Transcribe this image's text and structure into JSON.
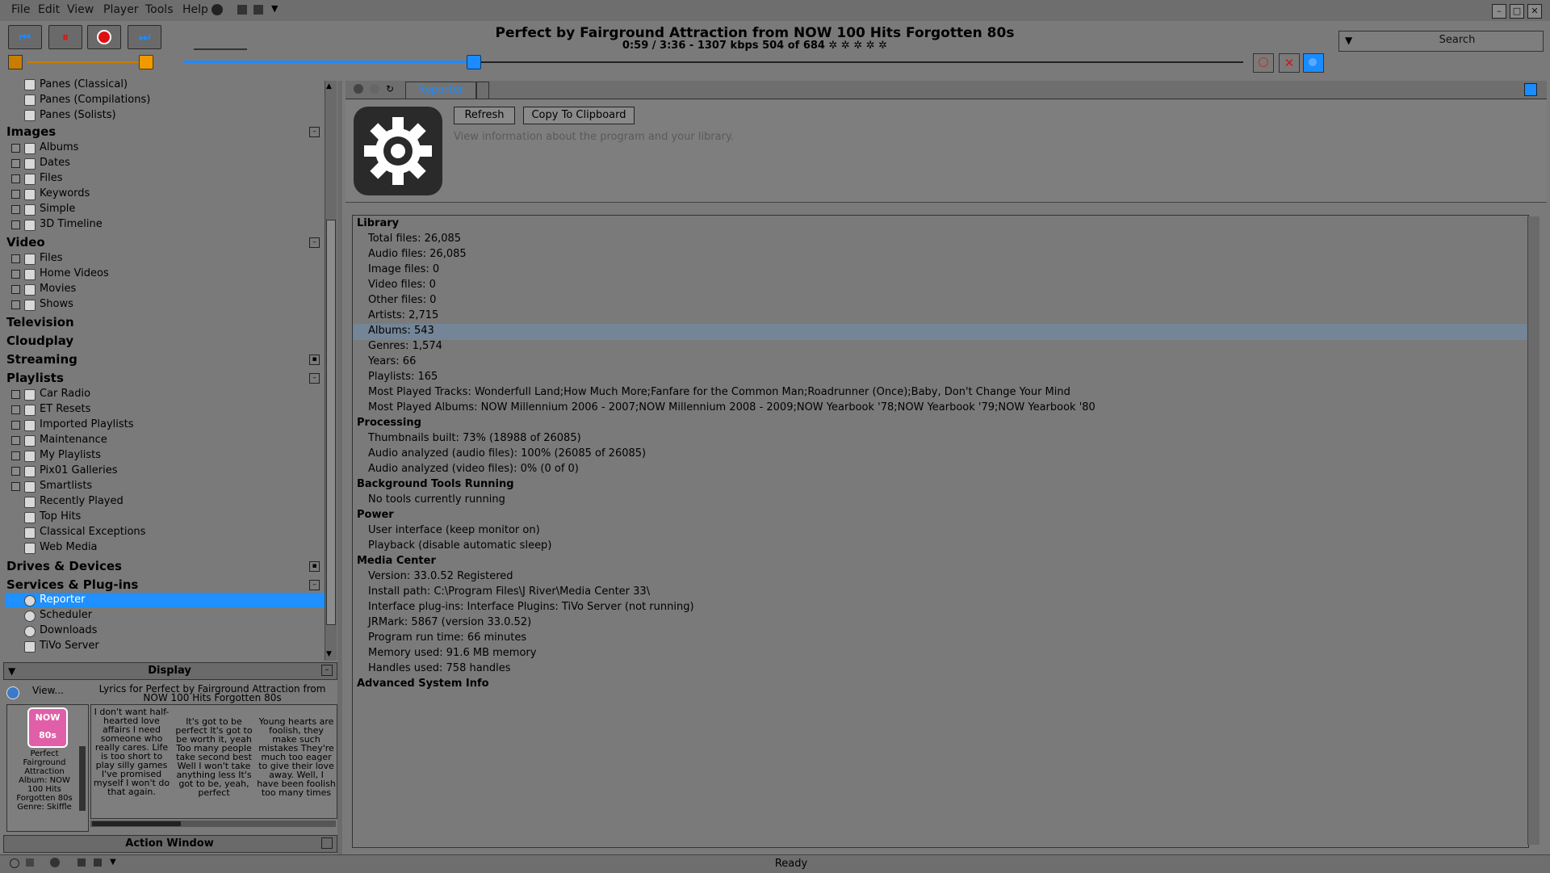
{
  "menu": [
    "File",
    "Edit",
    "View",
    "Player",
    "Tools",
    "Help"
  ],
  "now_playing": {
    "title": "Perfect by Fairground Attraction from NOW 100 Hits Forgotten 80s",
    "subtitle": "0:59 / 3:36 - 1307 kbps   504 of 684 ✲ ✲ ✲ ✲ ✲"
  },
  "playback": {
    "position_fraction": 0.273,
    "volume_fraction": 0.97
  },
  "search": {
    "label": "Search"
  },
  "tree": {
    "audio_items": [
      "Panes (Classical)",
      "Panes (Compilations)",
      "Panes (Solists)"
    ],
    "images": {
      "label": "Images",
      "items": [
        "Albums",
        "Dates",
        "Files",
        "Keywords",
        "Simple",
        "3D Timeline"
      ]
    },
    "video": {
      "label": "Video",
      "items": [
        "Files",
        "Home Videos",
        "Movies",
        "Shows"
      ]
    },
    "television": "Television",
    "cloudplay": "Cloudplay",
    "streaming": "Streaming",
    "playlists": {
      "label": "Playlists",
      "items": [
        "Car Radio",
        "ET Resets",
        "Imported Playlists",
        "Maintenance",
        "My Playlists",
        "Pix01 Galleries",
        "Smartlists",
        "Recently Played",
        "Top Hits",
        "Classical Exceptions",
        "Web Media"
      ]
    },
    "drives": "Drives & Devices",
    "services": {
      "label": "Services & Plug-ins",
      "items": [
        "Reporter",
        "Scheduler",
        "Downloads",
        "TiVo Server"
      ]
    }
  },
  "display": {
    "title": "Display",
    "view": "View...",
    "lyrics_heading": "Lyrics for Perfect by Fairground Attraction from NOW 100 Hits Forgotten 80s",
    "album_caption": "Perfect Fairground Attraction Album: NOW 100 Hits Forgotten 80s Genre: Skiffle",
    "album_art_text": "NOW 80s",
    "lyrics": [
      "I don't want half-hearted love affairs I need someone who really cares. Life is too short to play silly games I've promised myself I won't do that again.",
      "It's got to be perfect It's got to be worth it, yeah Too many people take second best Well I won't take anything less It's got to be, yeah, perfect",
      "Young hearts are foolish, they make such mistakes They're much too eager to give their love away. Well, I have been foolish too many times"
    ]
  },
  "action_window": "Action Window",
  "tab": {
    "label": "Reporter"
  },
  "header": {
    "refresh": "Refresh",
    "copy": "Copy To Clipboard",
    "description": "View information about the program and your library."
  },
  "report": {
    "library": {
      "heading": "Library",
      "lines": [
        "Total files: 26,085",
        "Audio files: 26,085",
        "Image files: 0",
        "Video files: 0",
        "Other files: 0",
        "Artists: 2,715",
        "Albums: 543",
        "Genres: 1,574",
        "Years: 66",
        "Playlists: 165",
        "Most Played Tracks: Wonderfull Land;How Much More;Fanfare for the Common Man;Roadrunner (Once);Baby, Don't Change Your Mind",
        "Most Played Albums: NOW Millennium 2006 - 2007;NOW Millennium 2008 - 2009;NOW Yearbook '78;NOW Yearbook '79;NOW Yearbook '80"
      ]
    },
    "processing": {
      "heading": "Processing",
      "lines": [
        "Thumbnails built: 73% (18988 of 26085)",
        "Audio analyzed (audio files): 100% (26085 of 26085)",
        "Audio analyzed (video files): 0% (0 of 0)"
      ]
    },
    "background": {
      "heading": "Background Tools Running",
      "lines": [
        "No tools currently running"
      ]
    },
    "power": {
      "heading": "Power",
      "lines": [
        "User interface (keep monitor on)",
        "Playback (disable automatic sleep)"
      ]
    },
    "media_center": {
      "heading": "Media Center",
      "lines": [
        "Version: 33.0.52 Registered",
        "Install path: C:\\Program Files\\J River\\Media Center 33\\",
        "Interface plug-ins: Interface Plugins: TiVo Server (not running)",
        "JRMark: 5867 (version 33.0.52)",
        "Program run time: 66 minutes",
        "Memory used: 91.6 MB memory",
        "Handles used: 758 handles"
      ]
    },
    "advanced": {
      "heading": "Advanced System Info"
    }
  },
  "status": "Ready",
  "colors": {
    "accent": "#1e90ff",
    "volume": "#f09a00",
    "stop": "#e01010"
  }
}
